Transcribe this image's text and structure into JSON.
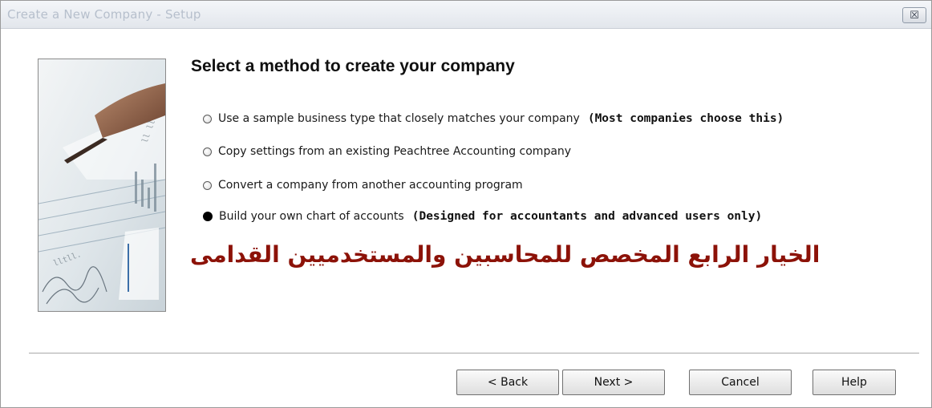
{
  "window": {
    "title": "Create a New Company - Setup",
    "close_glyph": "☒"
  },
  "main": {
    "heading": "Select a method to create your company",
    "options": [
      {
        "label": "Use a sample business type that closely matches your company",
        "note": "(Most companies choose this)",
        "selected": false
      },
      {
        "label": "Copy settings from an existing Peachtree Accounting company",
        "note": "",
        "selected": false
      },
      {
        "label": "Convert a company from another accounting program",
        "note": "",
        "selected": false
      },
      {
        "label": "Build your own chart of accounts",
        "note": "(Designed for accountants and advanced users only)",
        "selected": true
      }
    ],
    "annotation": "الخيار الرابع المخصص للمحاسبين والمستخدميين القدامى",
    "annotation_color": "#8c1208"
  },
  "buttons": {
    "back": "< Back",
    "next": "Next >",
    "cancel": "Cancel",
    "help": "Help"
  }
}
